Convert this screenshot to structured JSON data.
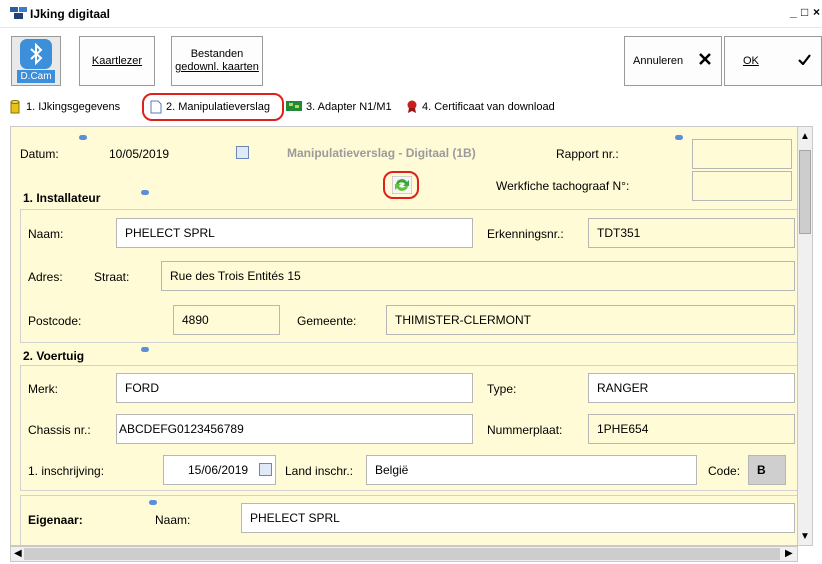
{
  "window": {
    "title": "IJking digitaal",
    "controls": [
      "_",
      "□",
      "×"
    ]
  },
  "toolbar": {
    "dcam_label": "D.Cam",
    "kaartlezer_label": "Kaartlezer",
    "bestanden_line1": "Bestanden",
    "bestanden_line2": "gedownl. kaarten",
    "annuleren_label": "Annuleren",
    "ok_label": "OK"
  },
  "tabs": [
    {
      "label": "1. IJkingsgegevens"
    },
    {
      "label": "2. Manipulatieverslag"
    },
    {
      "label": "3. Adapter N1/M1"
    },
    {
      "label": "4. Certificaat van download"
    }
  ],
  "header": {
    "datum_label": "Datum:",
    "datum_value": "10/05/2019",
    "form_title": "Manipulatieverslag - Digitaal (1B)",
    "rapport_label": "Rapport nr.:",
    "rapport_value": "",
    "werkfiche_label": "Werkfiche tachograaf N°:",
    "werkfiche_value": ""
  },
  "installateur": {
    "section_title": "1. Installateur",
    "naam_label": "Naam:",
    "naam_value": "PHELECT SPRL",
    "erkenning_label": "Erkenningsnr.:",
    "erkenning_value": "TDT351",
    "adres_label": "Adres:",
    "straat_label": "Straat:",
    "straat_value": "Rue des Trois Entités 15",
    "postcode_label": "Postcode:",
    "postcode_value": "4890",
    "gemeente_label": "Gemeente:",
    "gemeente_value": "THIMISTER-CLERMONT"
  },
  "voertuig": {
    "section_title": "2. Voertuig",
    "merk_label": "Merk:",
    "merk_value": "FORD",
    "type_label": "Type:",
    "type_value": "RANGER",
    "chassis_label": "Chassis nr.:",
    "chassis_value": "ABCDEFG0123456789",
    "nummerplaat_label": "Nummerplaat:",
    "nummerplaat_value": "1PHE654",
    "inschrijving_label": "1. inschrijving:",
    "inschrijving_value": "15/06/2019",
    "land_label": "Land inschr.:",
    "land_value": "België",
    "code_label": "Code:",
    "code_value": "B"
  },
  "eigenaar": {
    "label": "Eigenaar:",
    "naam_label": "Naam:",
    "naam_value": "PHELECT SPRL"
  }
}
